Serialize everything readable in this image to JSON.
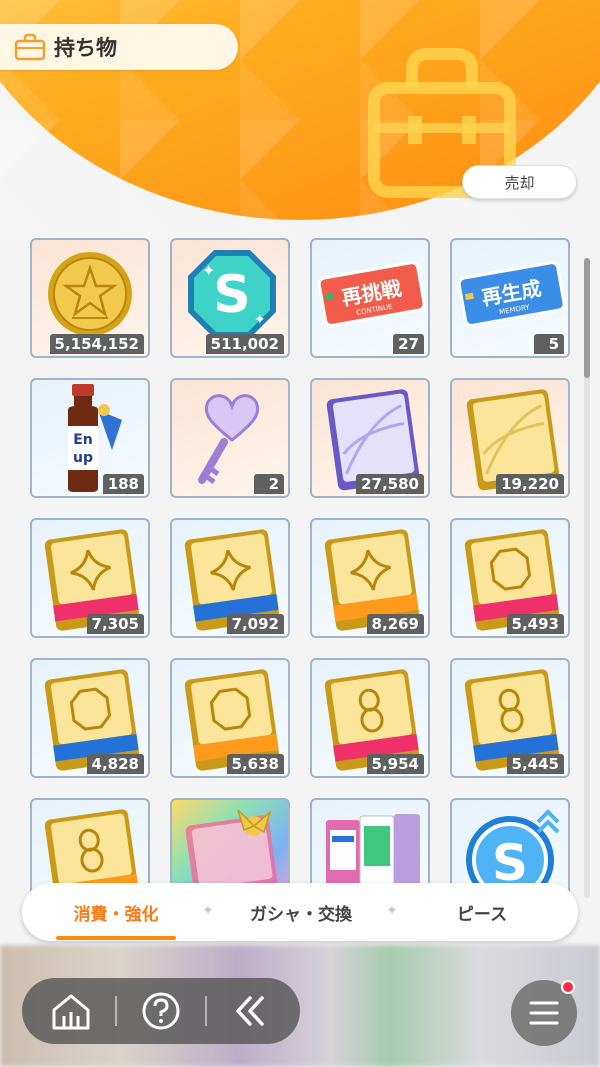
{
  "header": {
    "title": "持ち物",
    "title_icon": "bag-icon",
    "sell_button_label": "売却",
    "accent_color": "#ff8a10"
  },
  "items": [
    {
      "name": "coin",
      "count": "5,154,152"
    },
    {
      "name": "s-gem",
      "count": "511,002"
    },
    {
      "name": "continue-ticket",
      "label": "再挑戦",
      "sublabel": "CONTINUE",
      "count": "27"
    },
    {
      "name": "memory-ticket",
      "label": "再生成",
      "sublabel": "MEMORY",
      "count": "5"
    },
    {
      "name": "energy-drink",
      "bottle_text": "Enup",
      "count": "188"
    },
    {
      "name": "heart-key",
      "count": "2"
    },
    {
      "name": "purple-book",
      "count": "27,580"
    },
    {
      "name": "gold-book",
      "count": "19,220"
    },
    {
      "name": "sparkle-book-pink",
      "count": "7,305"
    },
    {
      "name": "sparkle-book-blue",
      "count": "7,092"
    },
    {
      "name": "sparkle-book-orange",
      "count": "8,269"
    },
    {
      "name": "octagon-book-pink",
      "count": "5,493"
    },
    {
      "name": "octagon-book-blue",
      "count": "4,828"
    },
    {
      "name": "octagon-book-orange",
      "count": "5,638"
    },
    {
      "name": "infinity-book-pink",
      "count": "5,954"
    },
    {
      "name": "infinity-book-blue",
      "count": "5,445"
    },
    {
      "name": "infinity-book-orange",
      "count": ""
    },
    {
      "name": "gift-book",
      "count": ""
    },
    {
      "name": "book-set",
      "count": ""
    },
    {
      "name": "s-coin-up",
      "count": ""
    }
  ],
  "tabs": [
    {
      "label": "消費・強化",
      "active": true
    },
    {
      "label": "ガシャ・交換",
      "active": false
    },
    {
      "label": "ピース",
      "active": false
    }
  ],
  "nav": {
    "home_icon": "home-icon",
    "help_icon": "help-icon",
    "back_icon": "back-icon",
    "menu_icon": "menu-icon"
  }
}
